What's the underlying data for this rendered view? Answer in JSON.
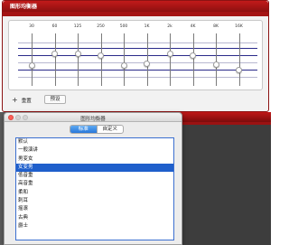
{
  "top_window": {
    "title": "图形均衡器",
    "frequency_labels": [
      "30",
      "60",
      "125",
      "250",
      "500",
      "1K",
      "2k",
      "4K",
      "8K",
      "16K"
    ],
    "band_levels": [
      0.38,
      0.62,
      0.62,
      0.58,
      0.38,
      0.42,
      0.62,
      0.58,
      0.4,
      0.3
    ],
    "add_button_label": "重置",
    "preset_button_label": "预设"
  },
  "dialog": {
    "title": "图形均衡器",
    "tabs": [
      {
        "label": "标准",
        "active": true
      },
      {
        "label": "自定义",
        "active": false
      }
    ],
    "presets": [
      {
        "label": "默认",
        "selected": false
      },
      {
        "label": "一般演讲",
        "selected": false
      },
      {
        "label": "男变女",
        "selected": false
      },
      {
        "label": "女变男",
        "selected": true
      },
      {
        "label": "低音重",
        "selected": false
      },
      {
        "label": "高音重",
        "selected": false
      },
      {
        "label": "柔和",
        "selected": false
      },
      {
        "label": "刺耳",
        "selected": false
      },
      {
        "label": "摇滚",
        "selected": false
      },
      {
        "label": "古典",
        "selected": false
      },
      {
        "label": "爵士",
        "selected": false
      }
    ]
  },
  "colors": {
    "title_red": "#b51616",
    "selection_blue": "#1f5fcb",
    "active_tab_blue": "#2f80e0"
  }
}
